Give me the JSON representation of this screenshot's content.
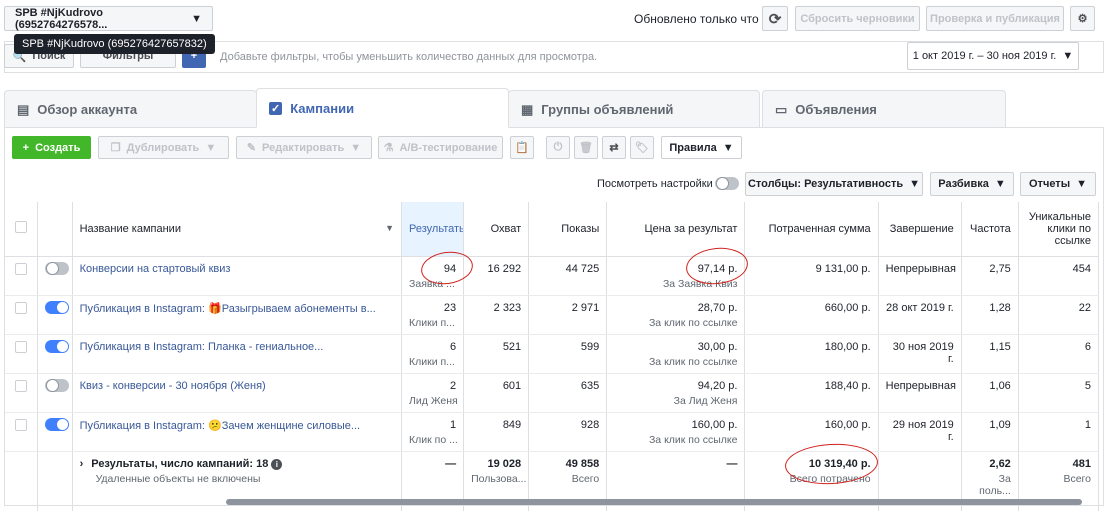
{
  "account": {
    "selector_label": "SPB #NjKudrovo (6952764276578...",
    "tooltip": "SPB #NjKudrovo (695276427657832)"
  },
  "header": {
    "updated_text": "Обновлено только что",
    "discard_label": "Сбросить черновики",
    "publish_label": "Проверка и публикация"
  },
  "filterbar": {
    "search_label": "Поиск",
    "filters_label": "Фильтры",
    "placeholder": "Добавьте фильтры, чтобы уменьшить количество данных для просмотра.",
    "date_range": "1 окт 2019 г. – 30 ноя 2019 г."
  },
  "tabs": [
    {
      "label": "Обзор аккаунта",
      "icon": "account-overview-icon"
    },
    {
      "label": "Кампании",
      "icon": "campaigns-icon"
    },
    {
      "label": "Группы объявлений",
      "icon": "adsets-icon"
    },
    {
      "label": "Объявления",
      "icon": "ads-icon"
    }
  ],
  "toolbar": {
    "create_label": "Создать",
    "duplicate_label": "Дублировать",
    "edit_label": "Редактировать",
    "ab_label": "A/B-тестирование",
    "rules_label": "Правила",
    "view_settings_label": "Посмотреть настройки",
    "columns_label": "Столбцы: Результативность",
    "breakdown_label": "Разбивка",
    "reports_label": "Отчеты"
  },
  "columns": {
    "name": "Название кампании",
    "results": "Результаты",
    "reach": "Охват",
    "impressions": "Показы",
    "cost": "Цена за результат",
    "spent": "Потраченная сумма",
    "end": "Завершение",
    "frequency": "Частота",
    "unique_clicks": "Уникальные клики по ссылке"
  },
  "rows": [
    {
      "name": "Конверсии на стартовый квиз",
      "toggle": "off",
      "results": "94",
      "results_sub": "Заявка ...",
      "reach": "16 292",
      "impressions": "44 725",
      "cost": "97,14 р.",
      "cost_sub": "За Заявка Квиз",
      "spent": "9 131,00 р.",
      "end": "Непрерывная",
      "frequency": "2,75",
      "unique_clicks": "454"
    },
    {
      "name": "Публикация в Instagram: 🎁Разыгрываем абонементы в...",
      "toggle": "on",
      "results": "23",
      "results_sub": "Клики п...",
      "reach": "2 323",
      "impressions": "2 971",
      "cost": "28,70 р.",
      "cost_sub": "За клик по ссылке",
      "spent": "660,00 р.",
      "end": "28 окт 2019 г.",
      "frequency": "1,28",
      "unique_clicks": "22"
    },
    {
      "name": "Публикация в Instagram: Планка - гениальное...",
      "toggle": "on",
      "results": "6",
      "results_sub": "Клики п...",
      "reach": "521",
      "impressions": "599",
      "cost": "30,00 р.",
      "cost_sub": "За клик по ссылке",
      "spent": "180,00 р.",
      "end": "30 ноя 2019 г.",
      "frequency": "1,15",
      "unique_clicks": "6"
    },
    {
      "name": "Квиз - конверсии - 30 ноября (Женя)",
      "toggle": "off",
      "results": "2",
      "results_sub": "Лид Женя",
      "reach": "601",
      "impressions": "635",
      "cost": "94,20 р.",
      "cost_sub": "За Лид Женя",
      "spent": "188,40 р.",
      "end": "Непрерывная",
      "frequency": "1,06",
      "unique_clicks": "5"
    },
    {
      "name": "Публикация в Instagram: 😕Зачем женщине силовые...",
      "toggle": "on",
      "results": "1",
      "results_sub": "Клик по ...",
      "reach": "849",
      "impressions": "928",
      "cost": "160,00 р.",
      "cost_sub": "За клик по ссылке",
      "spent": "160,00 р.",
      "end": "29 ноя 2019 г.",
      "frequency": "1,09",
      "unique_clicks": "1"
    }
  ],
  "summary": {
    "title": "Результаты, число кампаний: 18",
    "subtitle": "Удаленные объекты не включены",
    "results": "—",
    "reach": "19 028",
    "reach_sub": "Пользова...",
    "impressions": "49 858",
    "impressions_sub": "Всего",
    "cost": "—",
    "spent": "10 319,40 р.",
    "spent_sub": "Всего потрачено",
    "frequency": "2,62",
    "frequency_sub": "За поль...",
    "unique_clicks": "481",
    "unique_clicks_sub": "Всего"
  }
}
